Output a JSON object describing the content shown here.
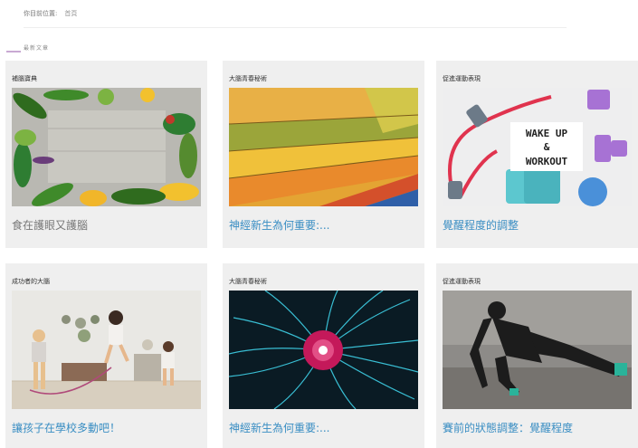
{
  "breadcrumb": {
    "prefix": "你目前位置:",
    "current": "首頁"
  },
  "subtitle": "最新文章",
  "colors": {
    "card_bg": "#efefef",
    "title_gray": "#777777",
    "title_blue": "#3a8ec3",
    "accent": "#c9a9d3"
  },
  "cards": [
    {
      "category": "補腦寶典",
      "title": "食在護眼又護腦",
      "image": "vegetables-on-wood-photo"
    },
    {
      "category": "大腦青春秘術",
      "title": "神經新生為何重要:...",
      "image": "colorful-shelves-photo"
    },
    {
      "category": "促進運動表現",
      "title": "覺醒程度的調整",
      "image": "workout-equipment-photo",
      "image_text": [
        "WAKE UP",
        "&",
        "WORKOUT"
      ]
    },
    {
      "category": "成功者的大腦",
      "title": "讓孩子在學校多動吧！",
      "image": "kids-jumping-rope-photo"
    },
    {
      "category": "大腦青春秘術",
      "title": "神經新生為何重要:...",
      "image": "plasma-neurons-photo"
    },
    {
      "category": "促進運動表現",
      "title": "賽前的狀態調整：覺醒程度",
      "image": "athlete-stretching-photo"
    }
  ]
}
